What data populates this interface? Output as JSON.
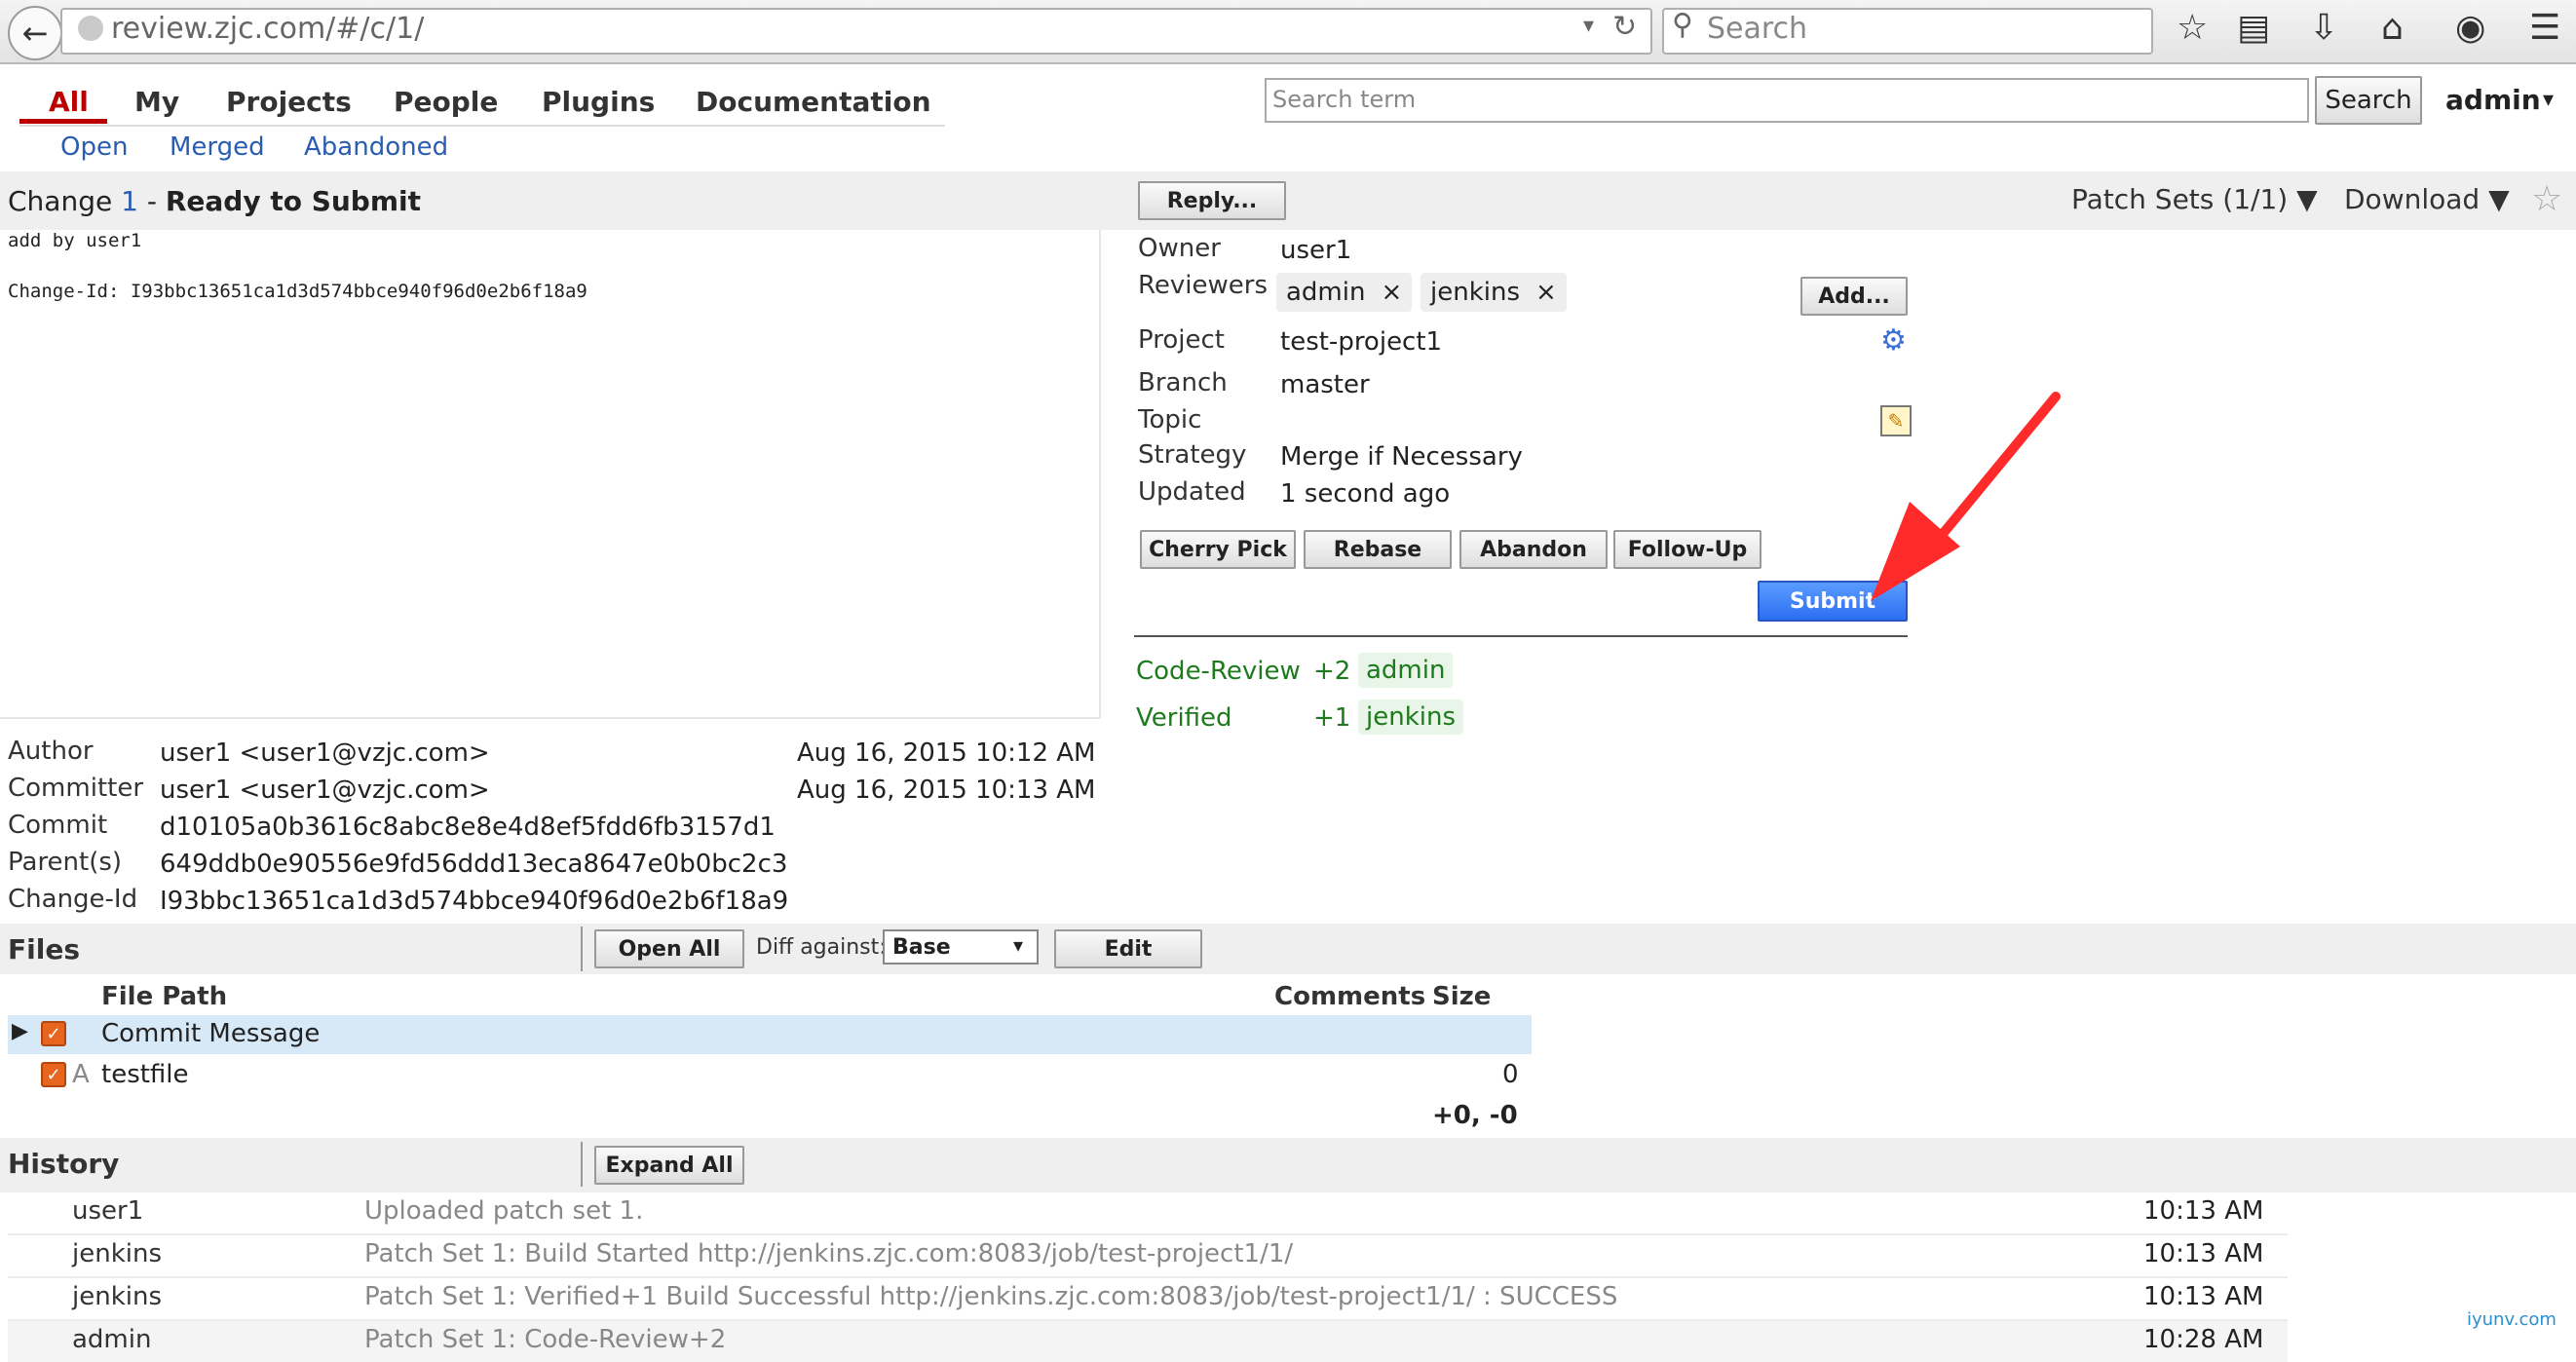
{
  "browser": {
    "url": "review.zjc.com/#/c/1/",
    "search_placeholder": "Search"
  },
  "nav": {
    "menu": [
      "All",
      "My",
      "Projects",
      "People",
      "Plugins",
      "Documentation"
    ],
    "submenu": [
      "Open",
      "Merged",
      "Abandoned"
    ],
    "search_placeholder": "Search term",
    "search_button": "Search",
    "user": "admin"
  },
  "change": {
    "label": "Change",
    "number": "1",
    "separator": " - ",
    "status": "Ready to Submit",
    "reply_button": "Reply...",
    "patch_sets": "Patch Sets (1/1) ▼",
    "download": "Download ▼",
    "message_line1": "add by user1",
    "message_line2": "Change-Id: I93bbc13651ca1d3d574bbce940f96d0e2b6f18a9"
  },
  "info": {
    "owner_label": "Owner",
    "owner": "user1",
    "reviewers_label": "Reviewers",
    "reviewers": [
      "admin",
      "jenkins"
    ],
    "remove_glyph": "×",
    "add_button": "Add...",
    "project_label": "Project",
    "project": "test-project1",
    "branch_label": "Branch",
    "branch": "master",
    "topic_label": "Topic",
    "strategy_label": "Strategy",
    "strategy": "Merge if Necessary",
    "updated_label": "Updated",
    "updated": "1 second ago"
  },
  "actions": {
    "cherry_pick": "Cherry Pick",
    "rebase": "Rebase",
    "abandon": "Abandon",
    "follow_up": "Follow-Up",
    "submit": "Submit"
  },
  "labels": {
    "code_review": "Code-Review",
    "code_review_score": "+2",
    "code_review_by": "admin",
    "verified": "Verified",
    "verified_score": "+1",
    "verified_by": "jenkins"
  },
  "commit": {
    "author_label": "Author",
    "author": "user1 <user1@vzjc.com>",
    "author_date": "Aug 16, 2015 10:12 AM",
    "committer_label": "Committer",
    "committer": "user1 <user1@vzjc.com>",
    "committer_date": "Aug 16, 2015 10:13 AM",
    "commit_label": "Commit",
    "commit": "d10105a0b3616c8abc8e8e4d8ef5fdd6fb3157d1",
    "parents_label": "Parent(s)",
    "parents": "649ddb0e90556e9fd56ddd13eca8647e0b0bc2c3",
    "change_id_label": "Change-Id",
    "change_id": "I93bbc13651ca1d3d574bbce940f96d0e2b6f18a9"
  },
  "files": {
    "title": "Files",
    "open_all": "Open All",
    "diff_against_label": "Diff against:",
    "diff_against_value": "Base",
    "edit_button": "Edit",
    "col_path": "File Path",
    "col_comments": "Comments",
    "col_size": "Size",
    "rows": [
      {
        "status": "",
        "path": "Commit Message",
        "size": ""
      },
      {
        "status": "A",
        "path": "testfile",
        "size": "0"
      }
    ],
    "total": "+0, -0"
  },
  "history": {
    "title": "History",
    "expand_all": "Expand All",
    "rows": [
      {
        "author": "user1",
        "message": "Uploaded patch set 1.",
        "time": "10:13 AM"
      },
      {
        "author": "jenkins",
        "message": "Patch Set 1: Build Started http://jenkins.zjc.com:8083/job/test-project1/1/",
        "time": "10:13 AM"
      },
      {
        "author": "jenkins",
        "message": "Patch Set 1: Verified+1 Build Successful http://jenkins.zjc.com:8083/job/test-project1/1/ : SUCCESS",
        "time": "10:13 AM"
      },
      {
        "author": "admin",
        "message": "Patch Set 1: Code-Review+2",
        "time": "10:28 AM"
      }
    ]
  },
  "watermark": "iyunv.com",
  "colors": {
    "accent": "#b00000",
    "link": "#2a5db0",
    "label_green": "#1d7a1d",
    "submit_blue": "#2c6ef2",
    "annotation_red": "#ff2a2a"
  }
}
